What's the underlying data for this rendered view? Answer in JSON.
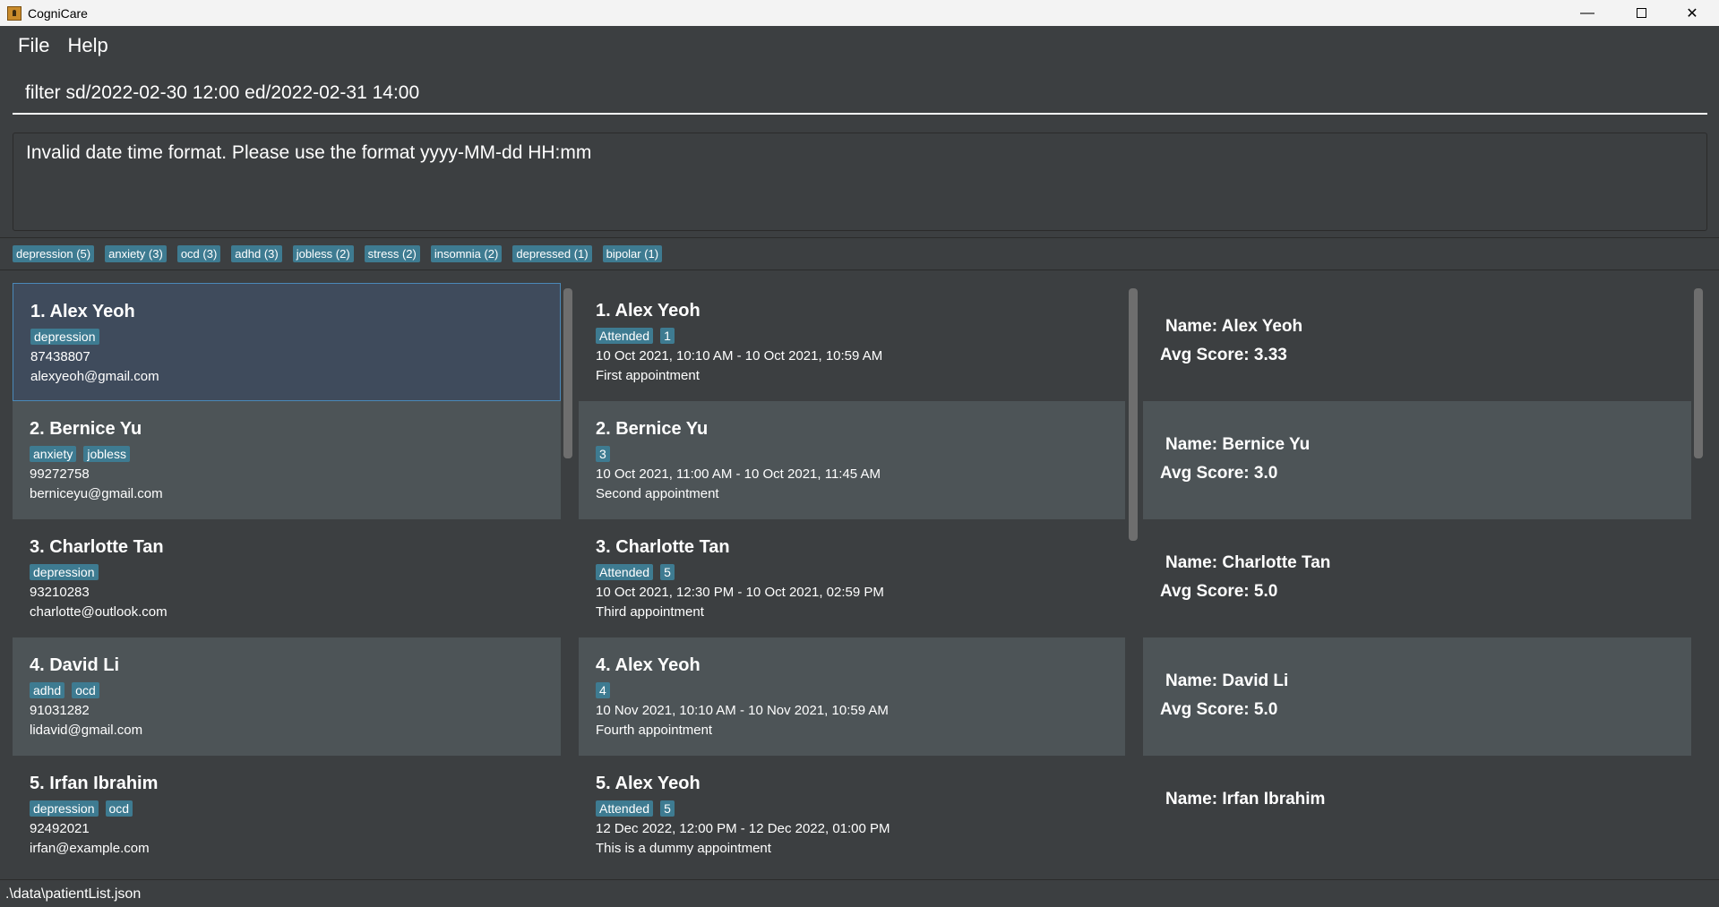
{
  "window": {
    "title": "CogniCare",
    "minimize_glyph": "—",
    "close_glyph": "✕"
  },
  "menu": {
    "file": "File",
    "help": "Help"
  },
  "command": {
    "value": "filter sd/2022-02-30 12:00 ed/2022-02-31 14:00"
  },
  "result": {
    "message": "Invalid date time format. Please use the format yyyy-MM-dd HH:mm"
  },
  "tags": [
    "depression (5)",
    "anxiety (3)",
    "ocd (3)",
    "adhd (3)",
    "jobless (2)",
    "stress (2)",
    "insomnia (2)",
    "depressed (1)",
    "bipolar (1)"
  ],
  "patients": [
    {
      "title": "1.  Alex Yeoh",
      "tags": [
        "depression"
      ],
      "phone": "87438807",
      "email": "alexyeoh@gmail.com"
    },
    {
      "title": "2.  Bernice Yu",
      "tags": [
        "anxiety",
        "jobless"
      ],
      "phone": "99272758",
      "email": "berniceyu@gmail.com"
    },
    {
      "title": "3.  Charlotte Tan",
      "tags": [
        "depression"
      ],
      "phone": "93210283",
      "email": "charlotte@outlook.com"
    },
    {
      "title": "4.  David Li",
      "tags": [
        "adhd",
        "ocd"
      ],
      "phone": "91031282",
      "email": "lidavid@gmail.com"
    },
    {
      "title": "5.  Irfan Ibrahim",
      "tags": [
        "depression",
        "ocd"
      ],
      "phone": "92492021",
      "email": "irfan@example.com"
    }
  ],
  "appointments": [
    {
      "title": "1.  Alex Yeoh",
      "tags": [
        "Attended",
        "1"
      ],
      "time": "10 Oct 2021, 10:10 AM - 10 Oct 2021, 10:59 AM",
      "desc": "First appointment"
    },
    {
      "title": "2.  Bernice Yu",
      "tags": [
        "3"
      ],
      "time": "10 Oct 2021, 11:00 AM - 10 Oct 2021, 11:45 AM",
      "desc": "Second appointment"
    },
    {
      "title": "3.  Charlotte Tan",
      "tags": [
        "Attended",
        "5"
      ],
      "time": "10 Oct 2021, 12:30 PM - 10 Oct 2021, 02:59 PM",
      "desc": "Third appointment"
    },
    {
      "title": "4.  Alex Yeoh",
      "tags": [
        "4"
      ],
      "time": "10 Nov 2021, 10:10 AM - 10 Nov 2021, 10:59 AM",
      "desc": "Fourth appointment"
    },
    {
      "title": "5.  Alex Yeoh",
      "tags": [
        "Attended",
        "5"
      ],
      "time": "12 Dec 2022, 12:00 PM - 12 Dec 2022, 01:00 PM",
      "desc": "This is a dummy appointment"
    }
  ],
  "scores": [
    {
      "name": "Name: Alex Yeoh",
      "avg": "Avg Score: 3.33"
    },
    {
      "name": "Name: Bernice Yu",
      "avg": "Avg Score: 3.0"
    },
    {
      "name": "Name: Charlotte Tan",
      "avg": "Avg Score: 5.0"
    },
    {
      "name": "Name: David Li",
      "avg": "Avg Score: 5.0"
    },
    {
      "name": "Name: Irfan Ibrahim",
      "avg": ""
    }
  ],
  "status": {
    "path": ".\\data\\patientList.json"
  },
  "colors": {
    "background": "#3c3f41",
    "card_light": "#4d5457",
    "tag": "#3e7b91",
    "selected": "#3f4b5c"
  }
}
